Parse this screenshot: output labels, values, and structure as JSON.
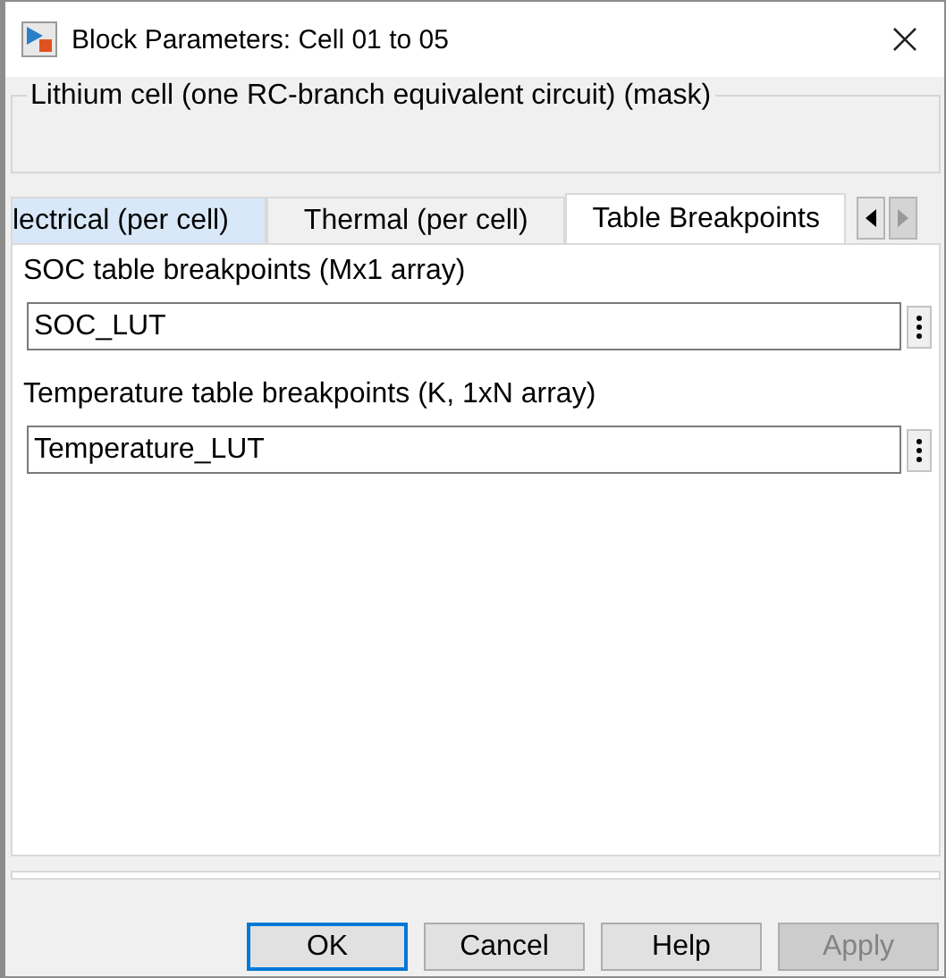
{
  "window": {
    "title": "Block Parameters: Cell 01 to 05"
  },
  "mask": {
    "description": "Lithium cell (one RC-branch equivalent circuit) (mask)"
  },
  "tabs": [
    {
      "label": "lectrical (per cell)",
      "selected": false,
      "highlighted": true
    },
    {
      "label": "Thermal (per cell)",
      "selected": false,
      "highlighted": false
    },
    {
      "label": "Table Breakpoints",
      "selected": true,
      "highlighted": false
    }
  ],
  "tab_scroll": {
    "left_disabled": false,
    "right_disabled": true
  },
  "parameters": [
    {
      "label": "SOC table breakpoints (Mx1 array)",
      "value": "SOC_LUT"
    },
    {
      "label": "Temperature table breakpoints (K, 1xN array)",
      "value": "Temperature_LUT"
    }
  ],
  "buttons": [
    {
      "label": "OK",
      "default": true,
      "disabled": false
    },
    {
      "label": "Cancel",
      "default": false,
      "disabled": false
    },
    {
      "label": "Help",
      "default": false,
      "disabled": false
    },
    {
      "label": "Apply",
      "default": false,
      "disabled": true
    }
  ]
}
